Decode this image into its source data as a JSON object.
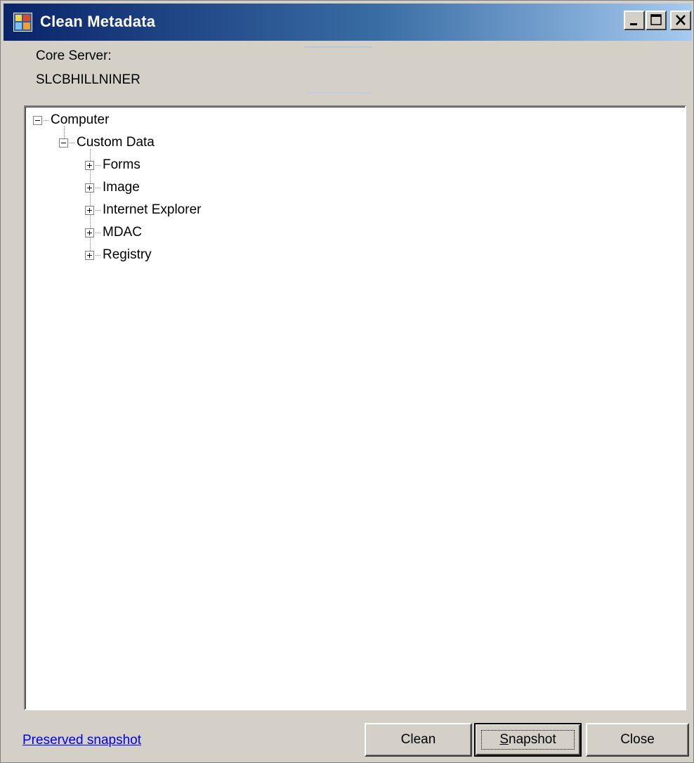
{
  "window": {
    "title": "Clean Metadata",
    "title_icon": "app-icon",
    "controls": [
      "minimize-icon",
      "maximize-icon",
      "close-icon"
    ]
  },
  "core_server": {
    "label": "Core Server:",
    "value": "SLCBHILLNINER"
  },
  "tree": {
    "root": {
      "label": "Computer",
      "expanded": true
    },
    "child": {
      "label": "Custom Data",
      "expanded": true
    },
    "items": [
      {
        "label": "Forms",
        "expanded": false
      },
      {
        "label": "Image",
        "expanded": false
      },
      {
        "label": "Internet Explorer",
        "expanded": false
      },
      {
        "label": "MDAC",
        "expanded": false
      },
      {
        "label": "Registry",
        "expanded": false
      }
    ]
  },
  "footer": {
    "link_label": "Preserved snapshot",
    "buttons": {
      "clean": "Clean",
      "snapshot_mnemonic": "S",
      "snapshot_rest": "napshot",
      "close": "Close"
    }
  },
  "colors": {
    "titlebar_start": "#0a246a",
    "titlebar_end": "#a6caf0",
    "face": "#d4d0c8",
    "link": "#0000ee"
  }
}
